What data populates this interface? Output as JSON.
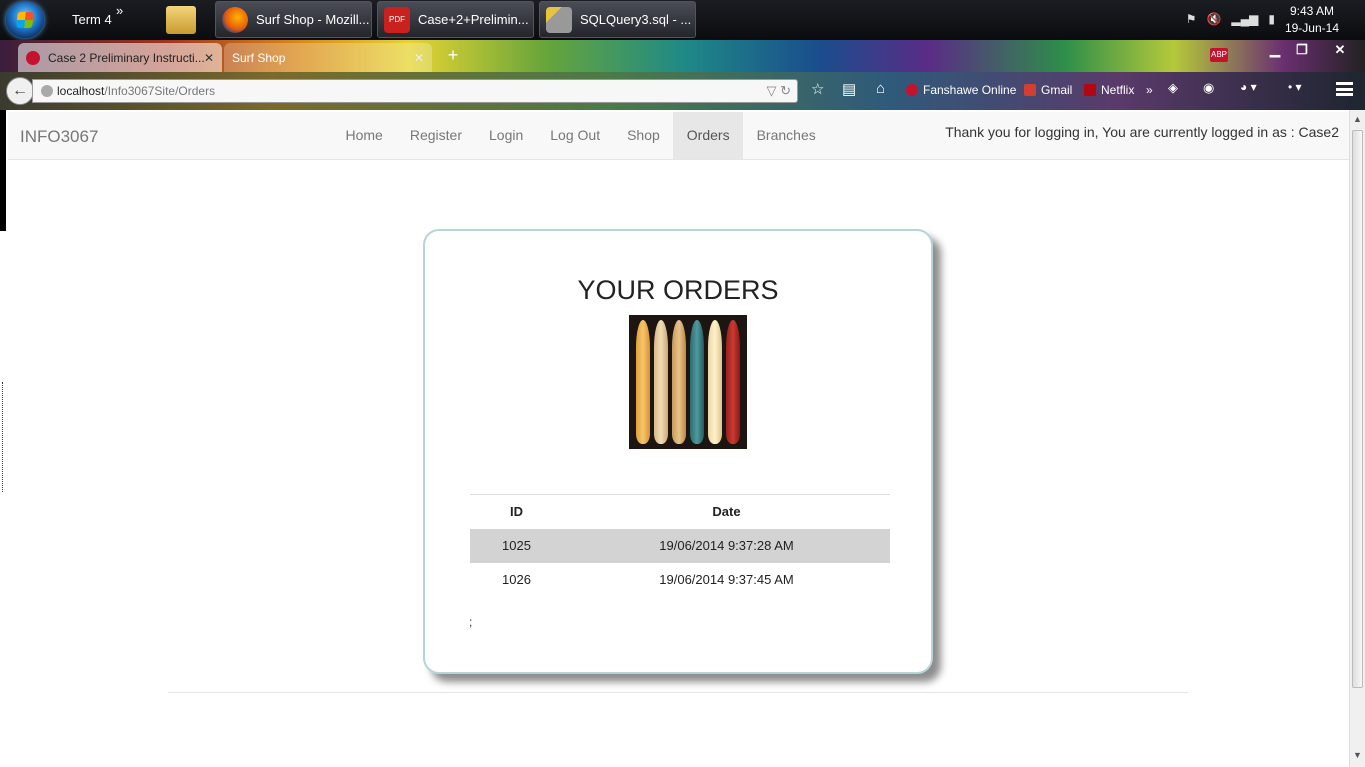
{
  "taskbar": {
    "toolbar_label": "Term 4",
    "more": "»",
    "windows": [
      {
        "label": "Surf Shop - Mozill..."
      },
      {
        "label": "Case+2+Prelimin..."
      },
      {
        "label": "SQLQuery3.sql - ..."
      }
    ],
    "pdf_icon_text": "PDF",
    "time": "9:43 AM",
    "date": "19-Jun-14"
  },
  "browser": {
    "tabs": [
      {
        "label": "Case 2 Preliminary Instructi..."
      },
      {
        "label": "Surf Shop"
      }
    ],
    "abp_label": "ABP",
    "url_host": "localhost",
    "url_path": "/Info3067Site/Orders",
    "bookmarks": [
      {
        "label": "Fanshawe Online"
      },
      {
        "label": "Gmail"
      },
      {
        "label": "Netflix"
      }
    ],
    "bookmarks_more": "»"
  },
  "site": {
    "brand": "INFO3067",
    "nav": [
      {
        "label": "Home"
      },
      {
        "label": "Register"
      },
      {
        "label": "Login"
      },
      {
        "label": "Log Out"
      },
      {
        "label": "Shop"
      },
      {
        "label": "Orders"
      },
      {
        "label": "Branches"
      }
    ],
    "login_message": "Thank you for logging in, You are currently logged in as : Case2"
  },
  "orders_panel": {
    "title": "YOUR ORDERS",
    "columns": [
      "ID",
      "Date"
    ],
    "rows": [
      {
        "id": "1025",
        "date": "19/06/2014 9:37:28 AM"
      },
      {
        "id": "1026",
        "date": "19/06/2014 9:37:45 AM"
      }
    ],
    "trailing_text": ";"
  },
  "colors": {
    "active_nav_bg": "#e7e7e7",
    "card_border": "#b7d4d8",
    "row_shade": "#d3d3d3"
  }
}
